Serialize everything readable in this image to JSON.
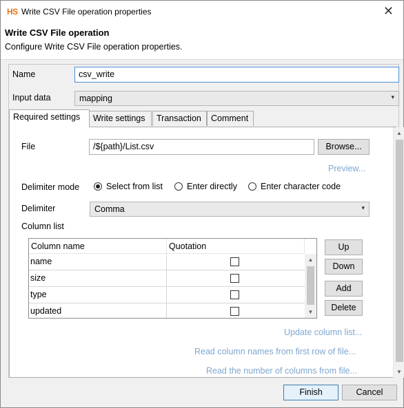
{
  "window": {
    "app_icon": "HS",
    "title": "Write CSV File operation properties",
    "close_glyph": "✕"
  },
  "header": {
    "title": "Write CSV File operation",
    "description": "Configure Write CSV File operation properties."
  },
  "form": {
    "name_label": "Name",
    "name_value": "csv_write",
    "input_label": "Input data",
    "input_value": "mapping"
  },
  "tabs": [
    "Required settings",
    "Write settings",
    "Transaction",
    "Comment"
  ],
  "required": {
    "file_label": "File",
    "file_value": "/${path}/List.csv",
    "browse_label": "Browse...",
    "preview_label": "Preview...",
    "delimiter_mode_label": "Delimiter mode",
    "mode_options": [
      "Select from list",
      "Enter directly",
      "Enter character code"
    ],
    "mode_selected": "Select from list",
    "delimiter_label": "Delimiter",
    "delimiter_value": "Comma",
    "column_list_label": "Column list",
    "columns_header": [
      "Column name",
      "Quotation"
    ],
    "columns": [
      {
        "name": "name",
        "quotation": false
      },
      {
        "name": "size",
        "quotation": false
      },
      {
        "name": "type",
        "quotation": false
      },
      {
        "name": "updated",
        "quotation": false
      }
    ],
    "buttons": {
      "up": "Up",
      "down": "Down",
      "add": "Add",
      "delete": "Delete"
    },
    "links": {
      "update": "Update column list...",
      "read_names": "Read column names from first row of file...",
      "read_count": "Read the number of columns from file..."
    }
  },
  "footer": {
    "finish": "Finish",
    "cancel": "Cancel"
  },
  "icons": {
    "combo_arrow": "▾",
    "scroll_up": "▲",
    "scroll_down": "▼"
  }
}
